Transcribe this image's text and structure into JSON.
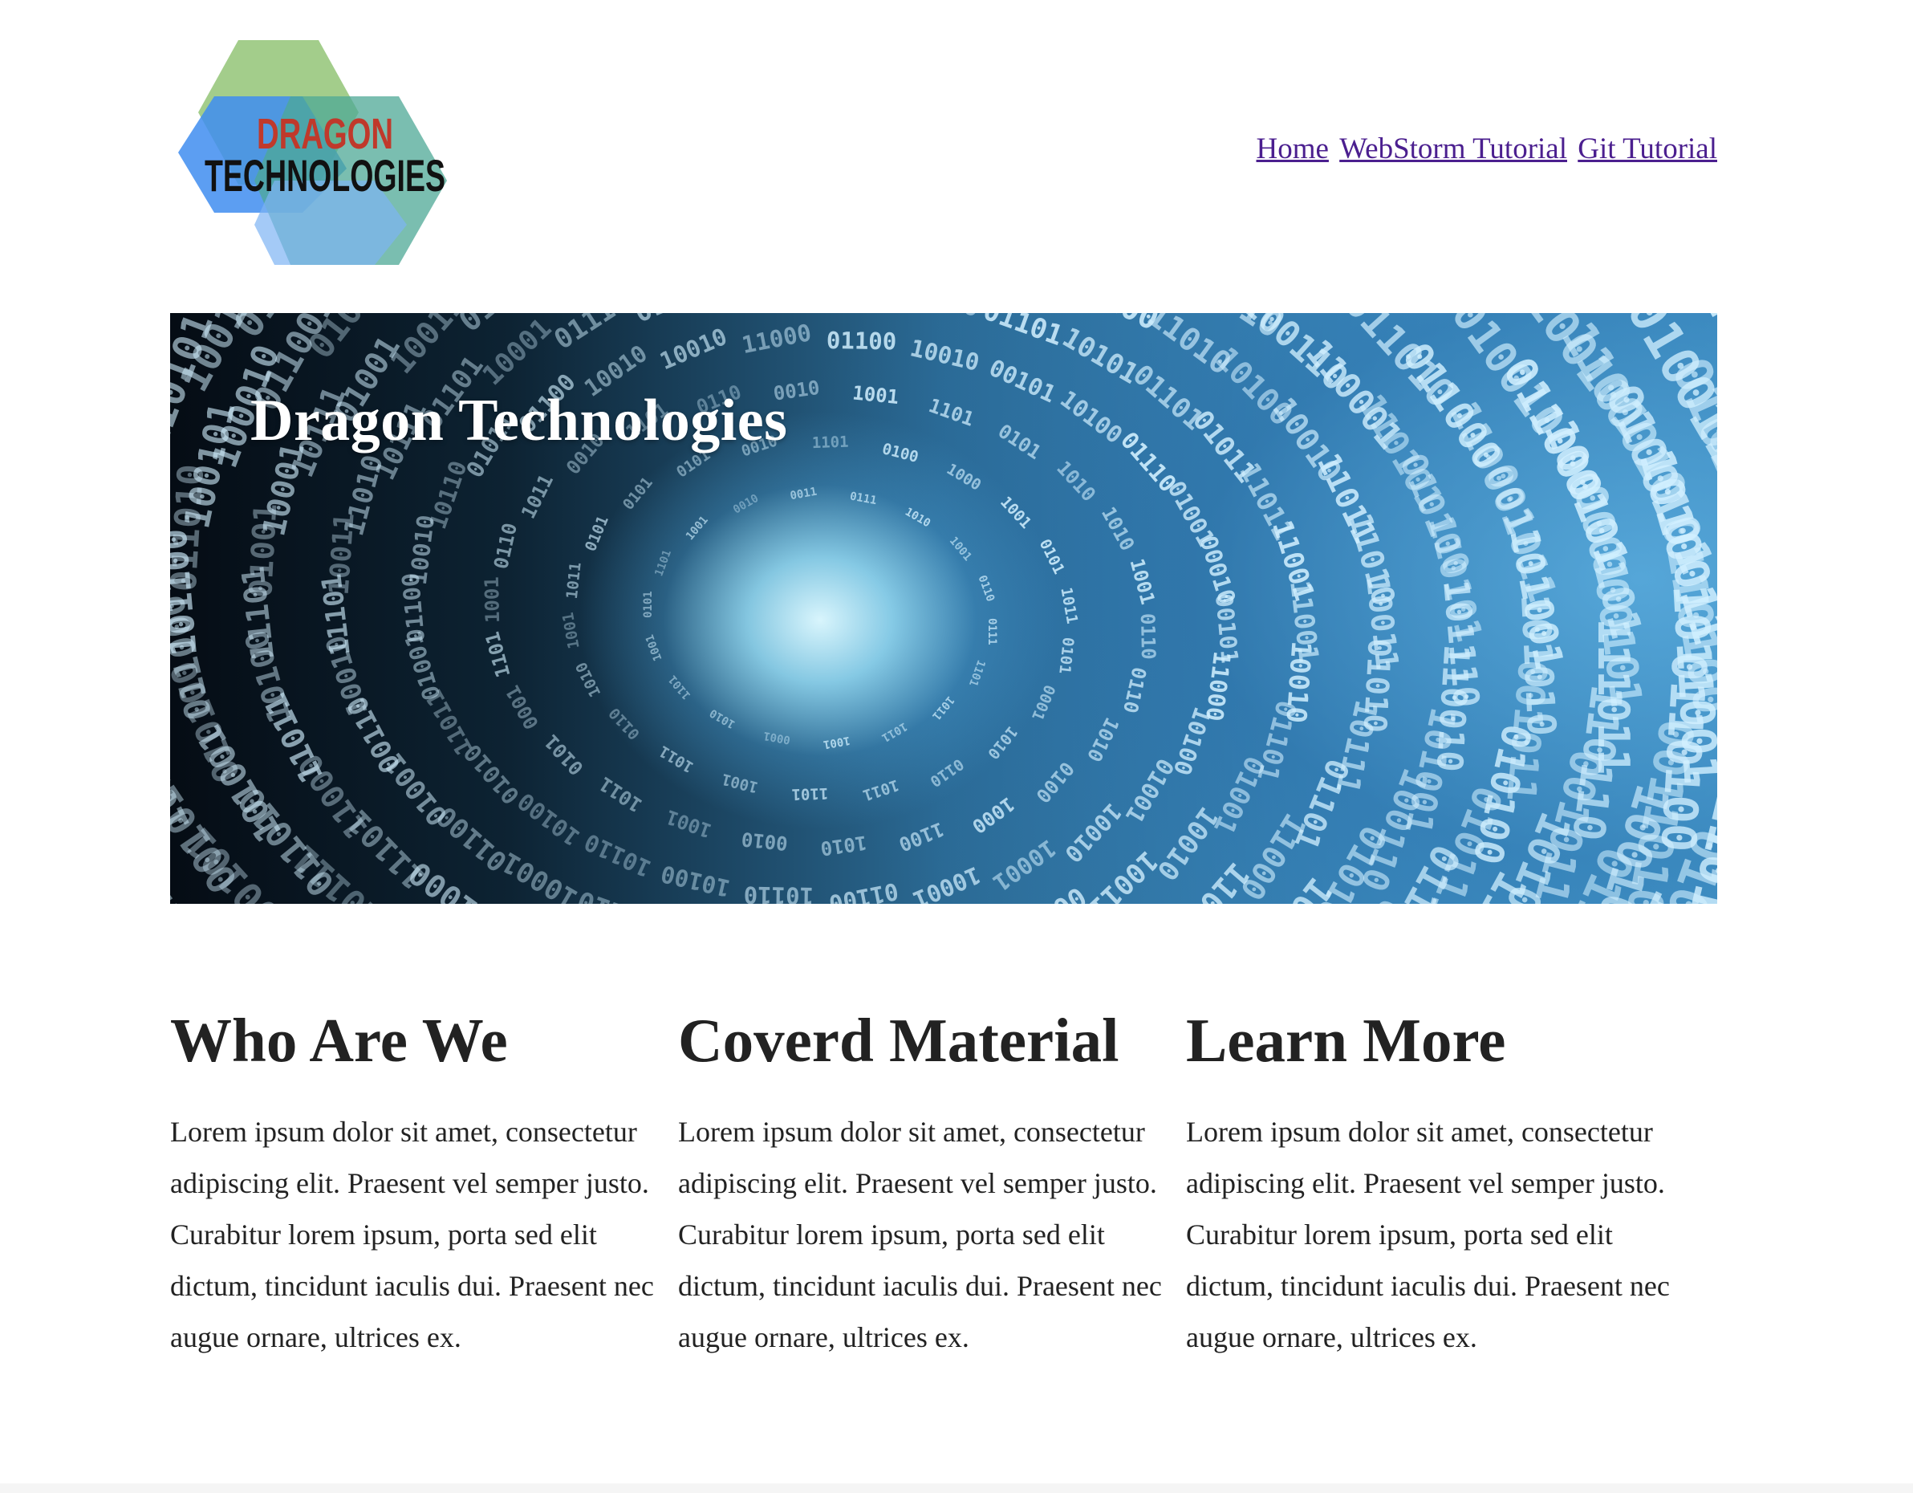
{
  "header": {
    "logo": {
      "line1": "DRAGON",
      "line2": "TECHNOLOGIES",
      "colors": {
        "hex_green": "#8cc06e",
        "hex_blue": "#3f8df0",
        "hex_teal": "#4ea896",
        "hex_lightblue": "#7db3f3",
        "text_red": "#c0392b",
        "text_black": "#111111"
      }
    },
    "nav": [
      {
        "label": "Home"
      },
      {
        "label": "WebStorm Tutorial"
      },
      {
        "label": "Git Tutorial"
      }
    ],
    "link_color": "#4b1f8f"
  },
  "hero": {
    "title": "Dragon Technologies",
    "image_icon": "binary-tunnel-image"
  },
  "columns": [
    {
      "heading": "Who Are We",
      "body": "Lorem ipsum dolor sit amet, consectetur adipiscing elit. Praesent vel semper justo. Curabitur lorem ipsum, porta sed elit dictum, tincidunt iaculis dui. Praesent nec augue ornare, ultrices ex."
    },
    {
      "heading": "Coverd Material",
      "body": "Lorem ipsum dolor sit amet, consectetur adipiscing elit. Praesent vel semper justo. Curabitur lorem ipsum, porta sed elit dictum, tincidunt iaculis dui. Praesent nec augue ornare, ultrices ex."
    },
    {
      "heading": "Learn More",
      "body": "Lorem ipsum dolor sit amet, consectetur adipiscing elit. Praesent vel semper justo. Curabitur lorem ipsum, porta sed elit dictum, tincidunt iaculis dui. Praesent nec augue ornare, ultrices ex."
    }
  ]
}
